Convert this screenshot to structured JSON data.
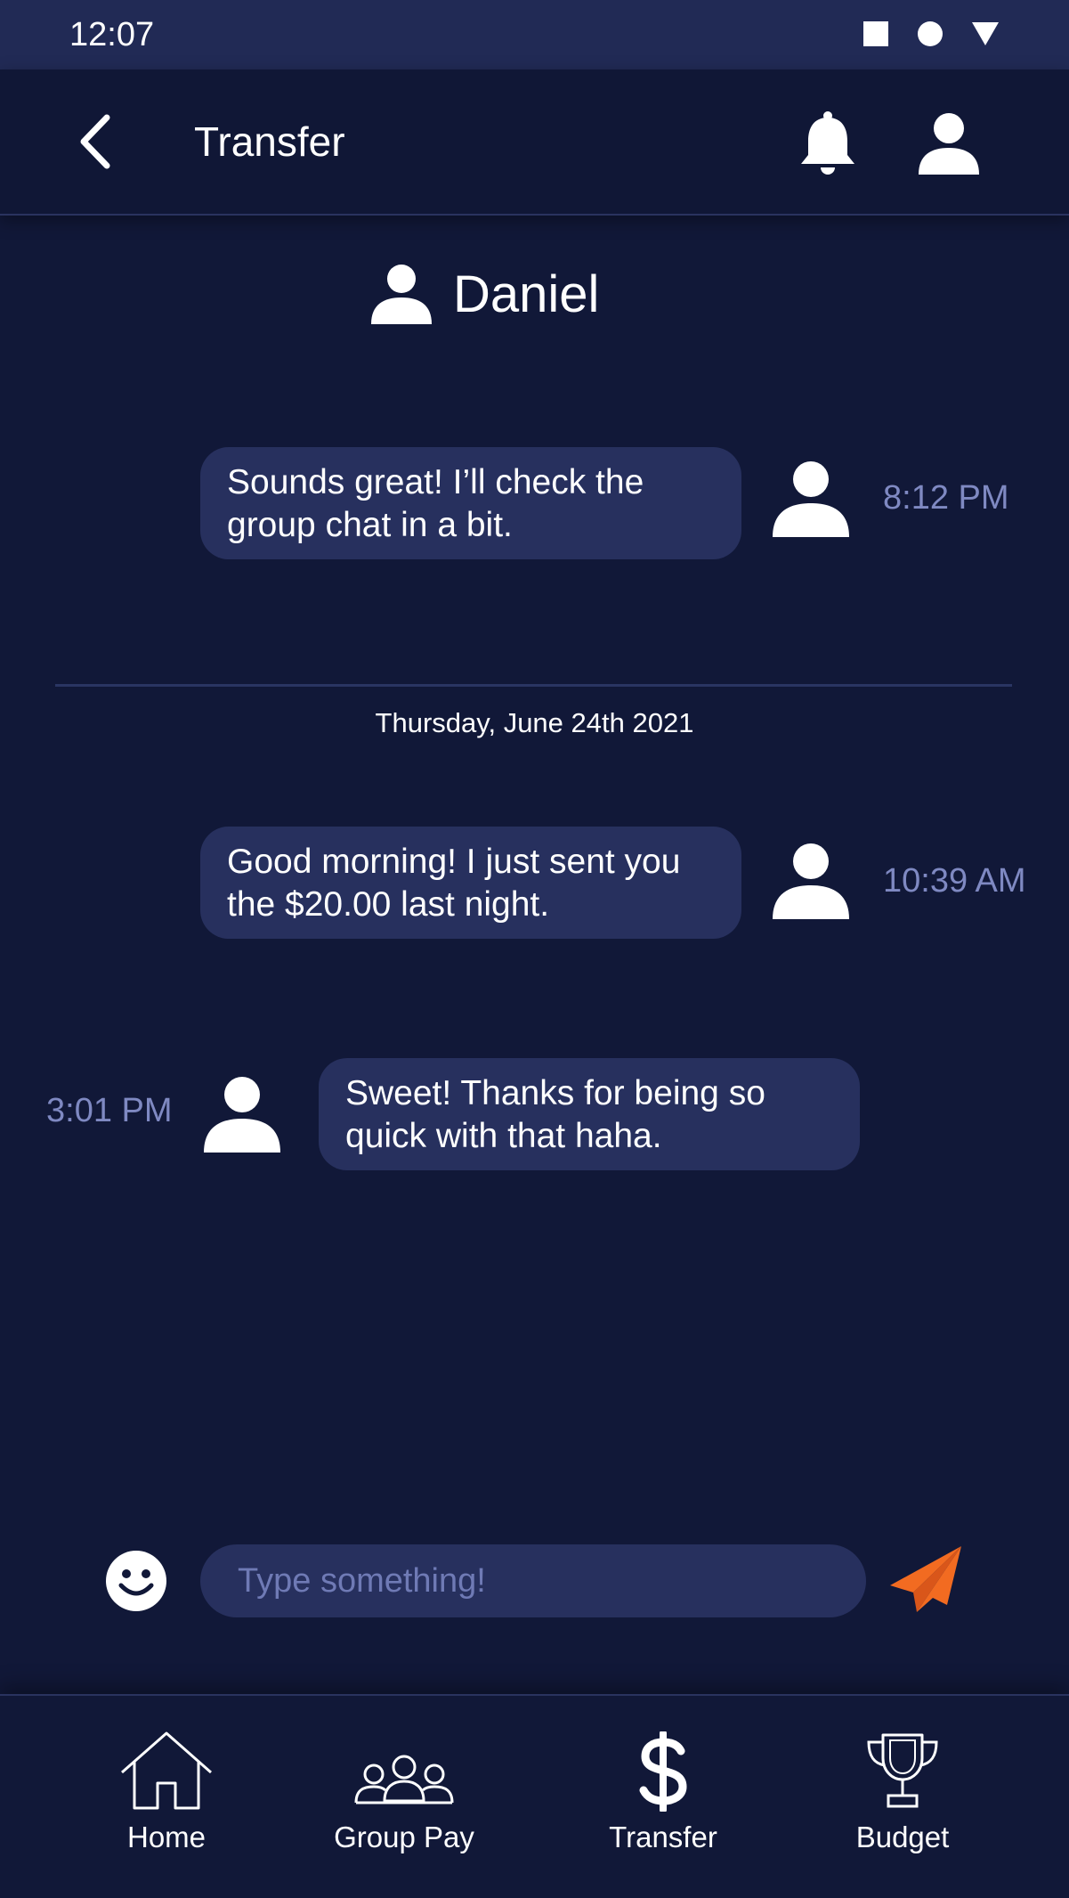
{
  "status_bar": {
    "time": "12:07",
    "icons": [
      "square-icon",
      "circle-icon",
      "triangle-icon"
    ]
  },
  "app_bar": {
    "title": "Transfer",
    "icons": [
      "back-arrow-icon",
      "bell-icon",
      "profile-icon"
    ]
  },
  "contact": {
    "name": "Daniel"
  },
  "messages": [
    {
      "text": "Sounds great! I’ll check the group chat in a bit.",
      "time": "8:12 PM",
      "side": "right"
    },
    {
      "text": "Good morning! I just sent you the $20.00 last night.",
      "time": "10:39 AM",
      "side": "right"
    },
    {
      "text": "Sweet! Thanks for being so quick with that haha.",
      "time": "3:01 PM",
      "side": "left"
    }
  ],
  "date_separator": "Thursday, June 24th 2021",
  "composer": {
    "placeholder": "Type something!"
  },
  "nav": [
    {
      "label": "Home",
      "icon": "home-icon"
    },
    {
      "label": "Group Pay",
      "icon": "group-icon"
    },
    {
      "label": "Transfer",
      "icon": "dollar-icon"
    },
    {
      "label": "Budget",
      "icon": "trophy-icon"
    }
  ],
  "colors": {
    "background": "#111838",
    "status_bar": "#212a55",
    "bubble": "#27305e",
    "timestamp": "#7f89c2",
    "placeholder": "#6f7ab5",
    "send_accent": "#f26b21"
  }
}
